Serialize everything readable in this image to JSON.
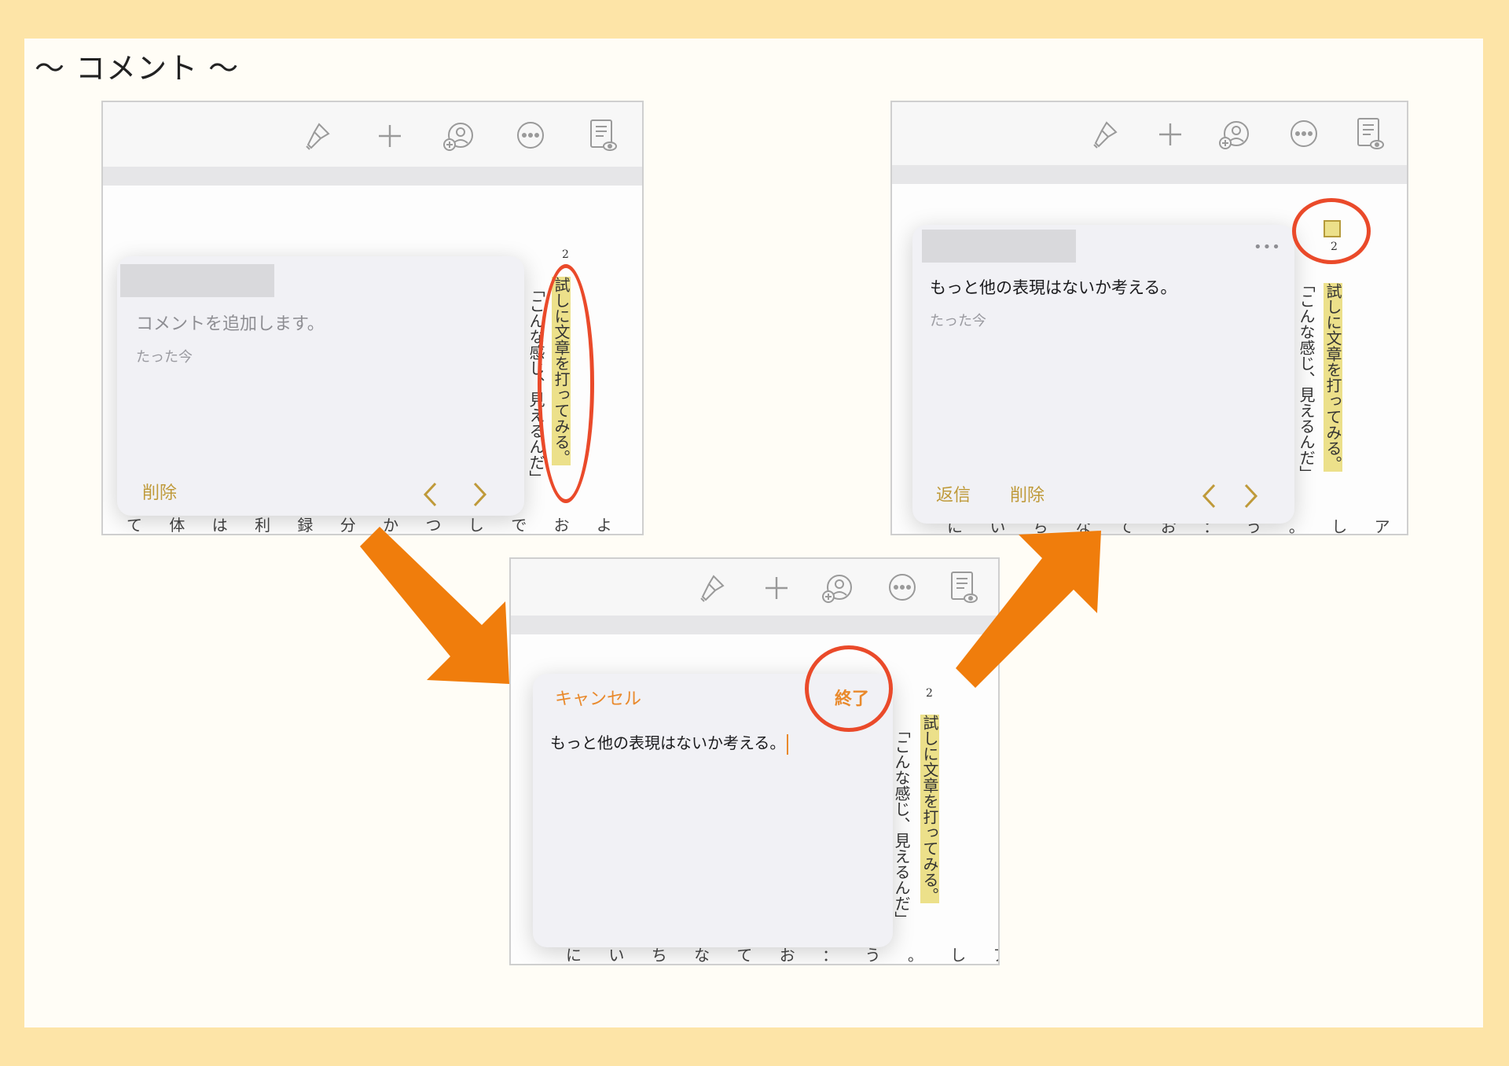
{
  "page": {
    "title": "〜 コメント 〜"
  },
  "colors": {
    "accent": "#bf9a3a",
    "accent_orange": "#e9892b",
    "highlight": "#ece08a",
    "annotation_red": "#ea4a2a",
    "arrow": "#f07d0c"
  },
  "toolbar_icons": [
    "brush-icon",
    "plus-icon",
    "add-collaborator-icon",
    "more-icon",
    "document-view-icon"
  ],
  "doc": {
    "page_number": "2",
    "highlighted_line": "試しに文章を打ってみる。",
    "second_line": "「こんな感じ、見えるんだ」",
    "bottom_text_a": "て 体 は 利 録 分 か つ し で お よ",
    "bottom_text_b": "に い ち な て お ： う 。 し ア"
  },
  "step1": {
    "comment_hint": "コメントを追加します。",
    "timestamp": "たった今",
    "delete_label": "削除"
  },
  "step2": {
    "cancel_label": "キャンセル",
    "done_label": "終了",
    "input_text": "もっと他の表現はないか考える。"
  },
  "step3": {
    "comment_text": "もっと他の表現はないか考える。",
    "timestamp": "たった今",
    "reply_label": "返信",
    "delete_label": "削除",
    "more_label": "•••"
  }
}
